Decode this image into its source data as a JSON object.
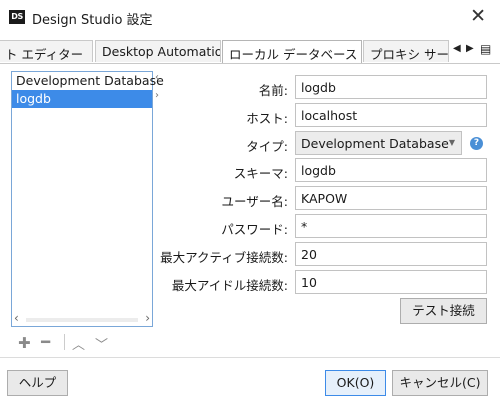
{
  "window": {
    "title": "Design Studio 設定",
    "logo": "DS"
  },
  "tabs": [
    {
      "label": "ト エディター"
    },
    {
      "label": "Desktop Automation"
    },
    {
      "label": "ローカル データベース",
      "active": true
    },
    {
      "label": "プロキシ サー"
    }
  ],
  "list": {
    "items": [
      "Development Database",
      "logdb"
    ],
    "selected_index": 1
  },
  "form": {
    "name_label": "名前:",
    "name_value": "logdb",
    "host_label": "ホスト:",
    "host_value": "localhost",
    "type_label": "タイプ:",
    "type_value": "Development Database",
    "schema_label": "スキーマ:",
    "schema_value": "logdb",
    "user_label": "ユーザー名:",
    "user_value": "KAPOW",
    "password_label": "パスワード:",
    "password_value": "*",
    "max_active_label": "最大アクティブ接続数:",
    "max_active_value": "20",
    "max_idle_label": "最大アイドル接続数:",
    "max_idle_value": "10",
    "test_button": "テスト接続"
  },
  "footer": {
    "help": "ヘルプ",
    "ok": "OK(O)",
    "cancel": "キャンセル(C)"
  },
  "icons": [
    "close-icon",
    "tab-scroll-left-icon",
    "tab-scroll-right-icon",
    "tab-menu-icon",
    "add-icon",
    "remove-icon",
    "move-up-icon",
    "move-down-icon",
    "help-icon"
  ],
  "colors": {
    "selection": "#3d8be8",
    "list_border": "#7aa7d8",
    "help_icon": "#4a8fd6"
  }
}
